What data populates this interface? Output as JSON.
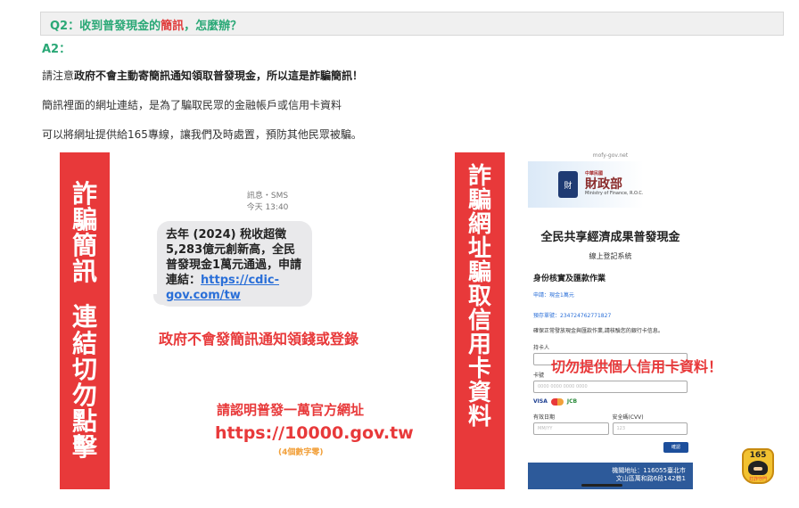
{
  "question": {
    "prefix": "Q2：收到普發現金的",
    "highlight": "簡訊",
    "suffix": "，怎麼辦？"
  },
  "answer_label": "A2：",
  "para1": {
    "lead": "請注意",
    "bold": "政府不會主動寄簡訊通知領取普發現金，所以這是詐騙簡訊！"
  },
  "para2": "簡訊裡面的網址連結，是為了騙取民眾的金融帳戶或信用卡資料",
  "para3": "可以將網址提供給165專線，讓我們及時處置，預防其他民眾被騙。",
  "left_graphic": {
    "vertical_a": [
      "詐",
      "騙",
      "簡",
      "訊"
    ],
    "vertical_b": [
      "連",
      "結",
      "切",
      "勿",
      "點",
      "擊"
    ],
    "sms_type": "訊息・SMS",
    "sms_time": "今天 13:40",
    "sms_body": "去年 (2024) 稅收超徵5,283億元創新高，全民普發現金1萬元通過，申請連結：",
    "sms_link": "https://cdic-gov.com/tw",
    "note_gov": "政府不會發簡訊通知領錢或登錄",
    "note_official": "請認明普發一萬官方網址",
    "official_url": "https://10000.gov.tw",
    "url_note": "(4個數字零)"
  },
  "right_graphic": {
    "vertical": [
      "詐",
      "騙",
      "網",
      "址",
      "騙",
      "取",
      "信",
      "用",
      "卡",
      "資",
      "料"
    ],
    "phone_url": "mofy-gov.net",
    "emblem_text": "財",
    "brand_small": "中華民國",
    "brand_main": "財政部",
    "brand_en": "Ministry of Finance, R.O.C.",
    "page_title": "全民共享經濟成果普發現金",
    "page_sub": "線上登記系統",
    "section": "身份核實及匯款作業",
    "apply_line": "申請：現金1萬元",
    "ref_line": "預存單號：2347247627718​27",
    "desc": "確保正常發放現金與匯款作業,請核驗您的銀行卡信息。",
    "cardholder_label": "持卡人",
    "card_label": "卡號",
    "card_placeholder": "0000 0000 0000 0000",
    "card_brands": [
      "VISA",
      "JCB"
    ],
    "expiry_label": "有效日期",
    "expiry_placeholder": "MM/YY",
    "cvv_label": "安全碼(CVV)",
    "cvv_placeholder": "123",
    "submit_label": "確認",
    "footer_line1": "機關地址：116055臺北市",
    "footer_line2": "文山區萬和路6段142巷1",
    "warning": "切勿提供個人信用卡資料！"
  },
  "badge": {
    "number": "165",
    "caption": "打詐守門"
  },
  "colors": {
    "accent_green": "#2aa876",
    "alert_red": "#e8393a",
    "link_blue": "#2a6fd8"
  }
}
